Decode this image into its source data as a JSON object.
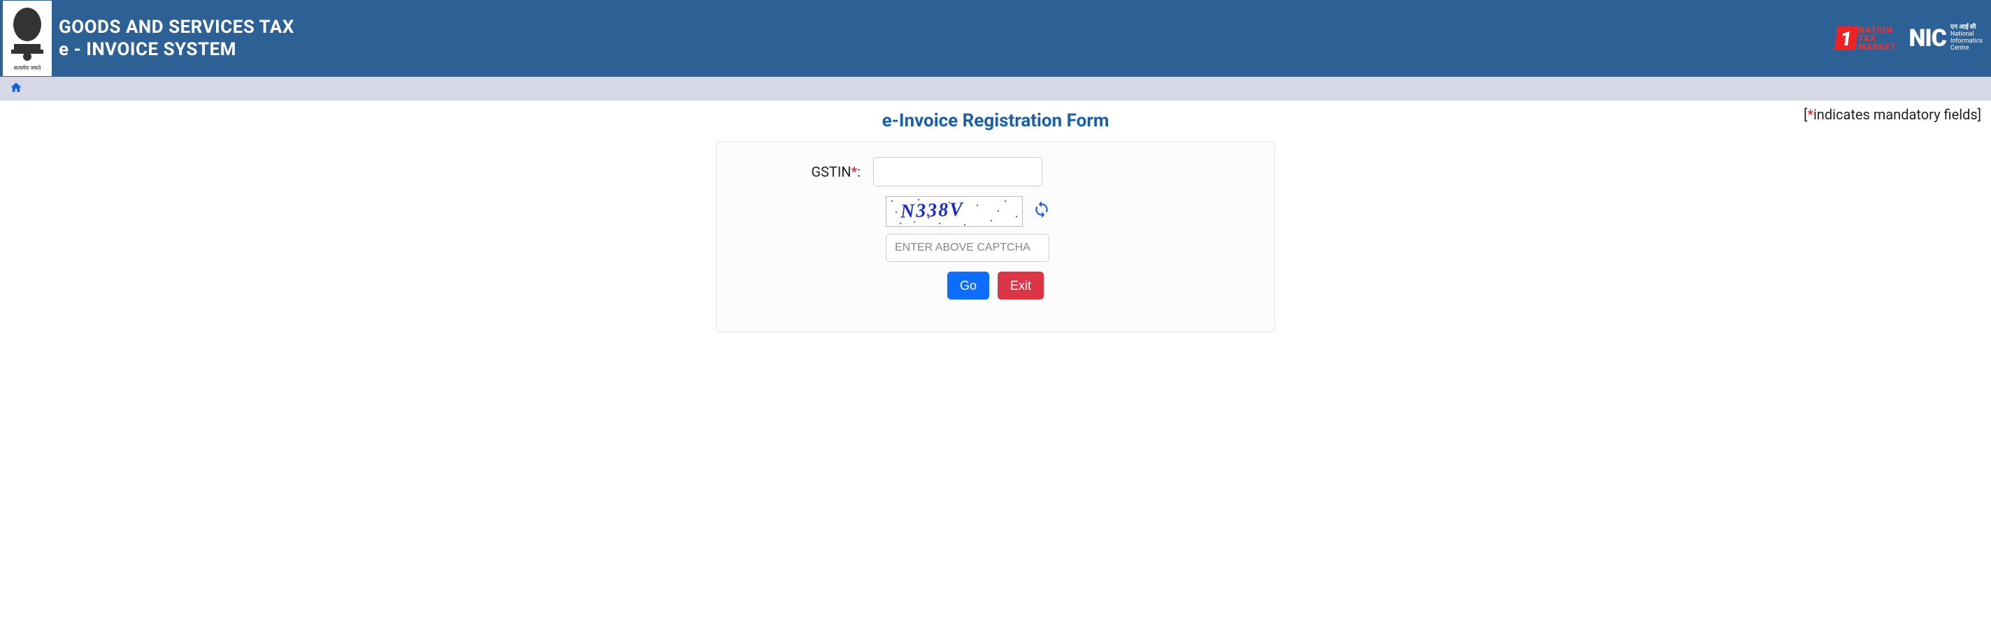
{
  "header": {
    "title_line1": "GOODS AND SERVICES TAX",
    "title_line2": "e - INVOICE SYSTEM",
    "ntm_line1": "NATION",
    "ntm_line2": "TAX",
    "ntm_line3": "MARKET",
    "nic_big": "NIC",
    "nic_small1": "एन आई सी",
    "nic_small2": "National",
    "nic_small3": "Informatics",
    "nic_small4": "Centre"
  },
  "mandatory_note": "indicates mandatory fields",
  "page_title": "e-Invoice Registration Form",
  "form": {
    "gstin_label": "GSTIN",
    "gstin_value": "",
    "captcha_text": "N338V",
    "captcha_placeholder": "ENTER ABOVE CAPTCHA",
    "captcha_value": "",
    "go_label": "Go",
    "exit_label": "Exit"
  }
}
